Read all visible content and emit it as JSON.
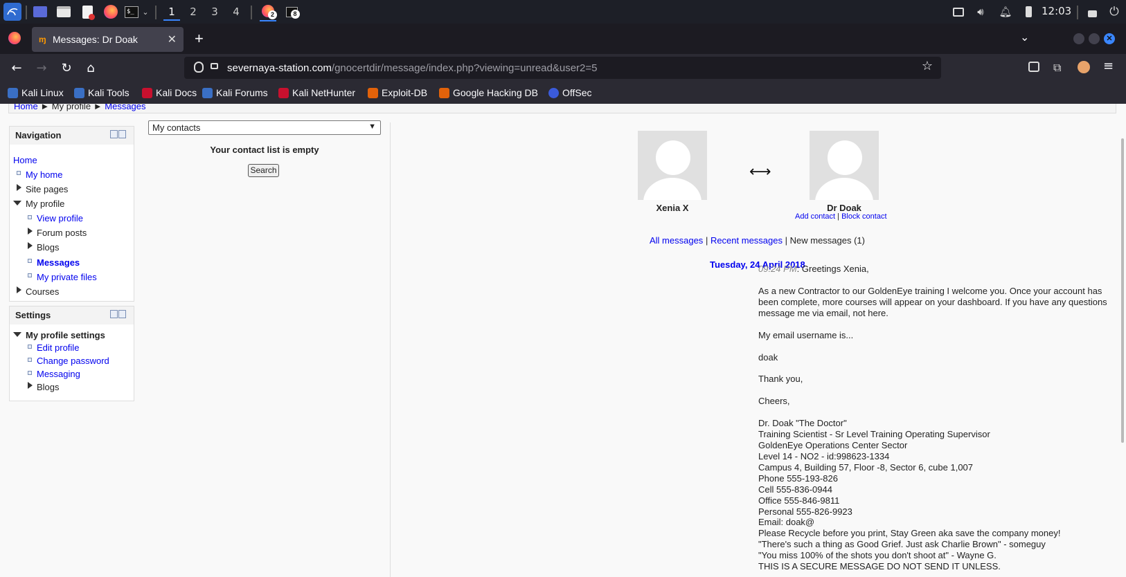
{
  "taskbar": {
    "workspaces": [
      "1",
      "2",
      "3",
      "4"
    ],
    "firefox_badge": "2",
    "terminal_badge": "8",
    "clock": "12:03"
  },
  "browser": {
    "tab_title": "Messages: Dr Doak",
    "url_domain": "severnaya-station.com",
    "url_path": "/gnocertdir/message/index.php?viewing=unread&user2=5",
    "bookmarks": [
      "Kali Linux",
      "Kali Tools",
      "Kali Docs",
      "Kali Forums",
      "Kali NetHunter",
      "Exploit-DB",
      "Google Hacking DB",
      "OffSec"
    ]
  },
  "breadcrumb": {
    "home": "Home",
    "profile": "My profile",
    "messages": "Messages"
  },
  "navigation": {
    "title": "Navigation",
    "items": [
      "Home",
      "My home",
      "Site pages",
      "My profile",
      "View profile",
      "Forum posts",
      "Blogs",
      "Messages",
      "My private files",
      "Courses"
    ]
  },
  "settings": {
    "title": "Settings",
    "items": [
      "My profile settings",
      "Edit profile",
      "Change password",
      "Messaging",
      "Blogs"
    ]
  },
  "contacts": {
    "select_value": "My contacts",
    "empty_text": "Your contact list is empty",
    "search_label": "Search"
  },
  "conversation": {
    "user1_name": "Xenia X",
    "user2_name": "Dr Doak",
    "add_contact": "Add contact",
    "block_contact": "Block contact",
    "tab_all": "All messages",
    "tab_recent": "Recent messages",
    "tab_new": "New messages (1)",
    "date": "Tuesday, 24 April 2018",
    "time": "09:24 PM",
    "greeting": ": Greetings Xenia,",
    "lines": [
      "As a new Contractor to our GoldenEye training I welcome you. Once your account has",
      "been complete, more courses will appear on your dashboard. If you have any questions",
      "message me via email, not here.",
      "My email username is...",
      "doak",
      "Thank you,",
      "Cheers,",
      "Dr. Doak \"The Doctor\"",
      "Training Scientist - Sr Level Training Operating Supervisor",
      "GoldenEye Operations Center Sector",
      "Level 14 - NO2 - id:998623-1334",
      "Campus 4, Building 57, Floor -8, Sector 6, cube 1,007",
      "Phone 555-193-826",
      "Cell 555-836-0944",
      "Office 555-846-9811",
      "Personal 555-826-9923",
      "Email: doak@",
      "Please Recycle before you print, Stay Green aka save the company money!",
      "\"There's such a thing as Good Grief. Just ask Charlie Brown\" - someguy",
      "\"You miss 100% of the shots you don't shoot at\" - Wayne G.",
      "THIS IS A SECURE MESSAGE DO NOT SEND IT UNLESS."
    ]
  }
}
